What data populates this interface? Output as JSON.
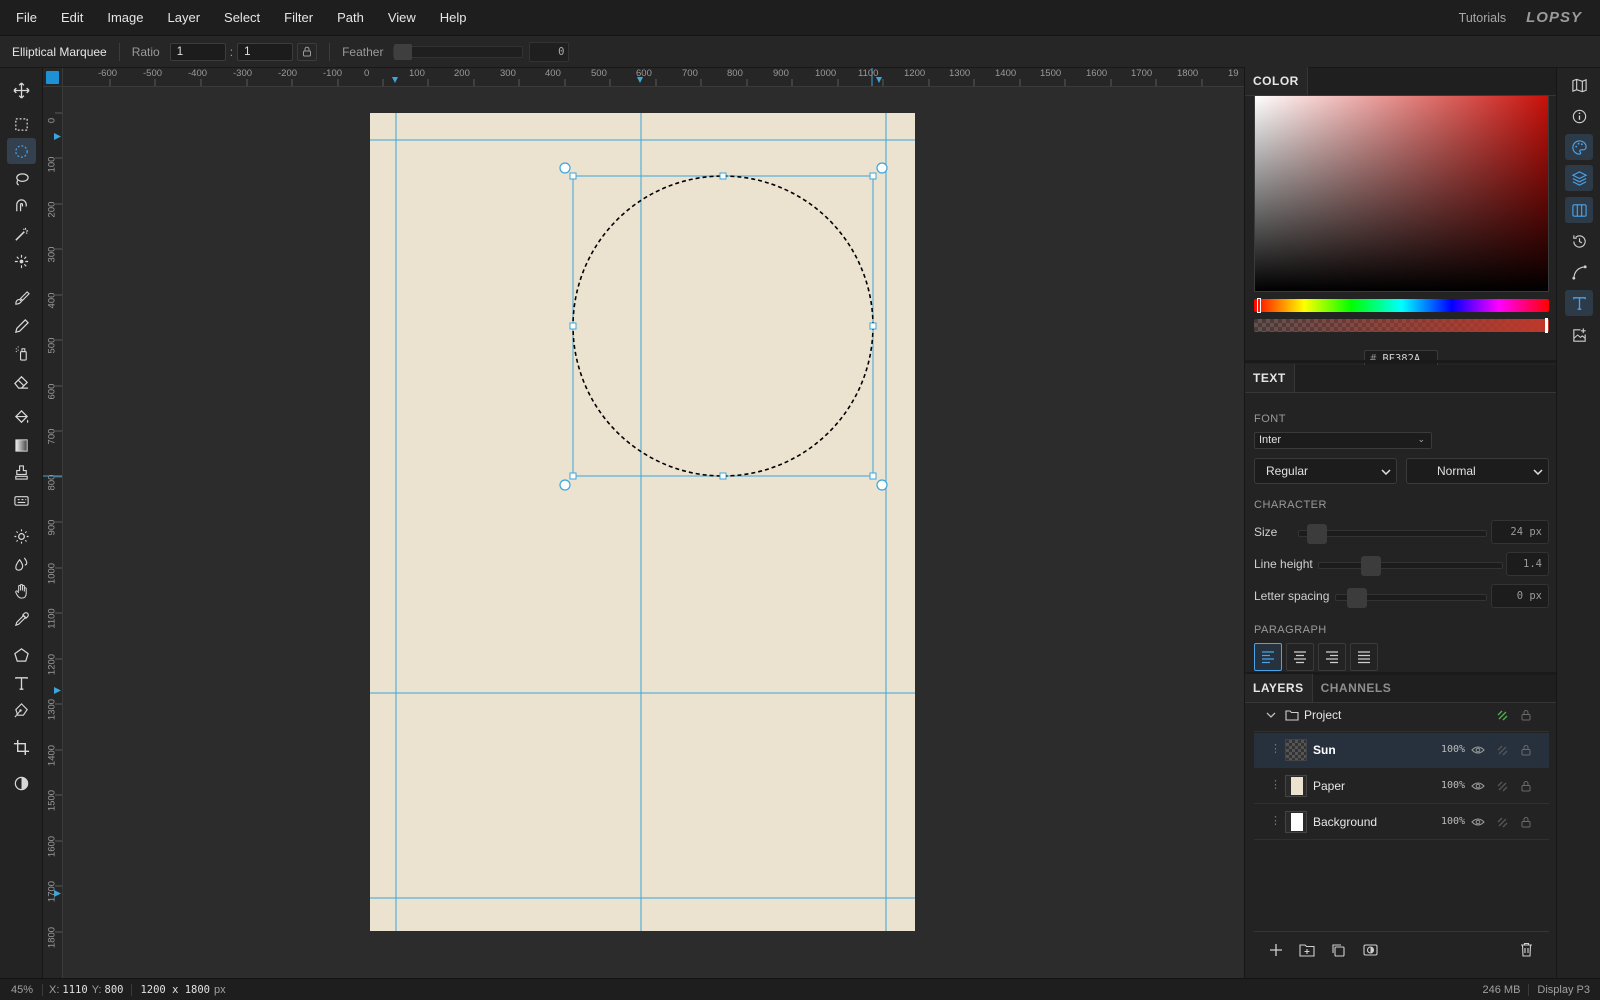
{
  "menu": {
    "items": [
      "File",
      "Edit",
      "Image",
      "Layer",
      "Select",
      "Filter",
      "Path",
      "View",
      "Help"
    ],
    "tutorials": "Tutorials",
    "logo": "LOPSY"
  },
  "options": {
    "tool_name": "Elliptical Marquee",
    "ratio_label": "Ratio",
    "ratio_w": "1",
    "ratio_sep": ":",
    "ratio_h": "1",
    "feather_label": "Feather",
    "feather_value": "0"
  },
  "tools": [
    {
      "name": "move-tool",
      "icon": "move-icon"
    },
    {
      "name": "rect-marquee-tool",
      "icon": "rect-marquee-icon"
    },
    {
      "name": "ellipse-marquee-tool",
      "icon": "ellipse-marquee-icon",
      "active": true
    },
    {
      "name": "lasso-tool",
      "icon": "lasso-icon"
    },
    {
      "name": "magnetic-lasso-tool",
      "icon": "magnetic-lasso-icon"
    },
    {
      "name": "magic-wand-tool",
      "icon": "magic-wand-icon"
    },
    {
      "name": "quick-select-tool",
      "icon": "quick-select-icon"
    },
    {
      "name": "brush-tool",
      "icon": "brush-icon"
    },
    {
      "name": "pencil-tool",
      "icon": "pencil-icon"
    },
    {
      "name": "spray-tool",
      "icon": "spray-icon"
    },
    {
      "name": "eraser-tool",
      "icon": "eraser-icon"
    },
    {
      "name": "bucket-tool",
      "icon": "paint-bucket-icon"
    },
    {
      "name": "gradient-tool",
      "icon": "gradient-icon"
    },
    {
      "name": "stamp-tool",
      "icon": "clone-stamp-icon"
    },
    {
      "name": "pattern-tool",
      "icon": "pattern-stamp-icon"
    },
    {
      "name": "dodge-tool",
      "icon": "dodge-icon"
    },
    {
      "name": "blur-tool",
      "icon": "blur-icon"
    },
    {
      "name": "hand-tool",
      "icon": "hand-icon"
    },
    {
      "name": "eyedropper-tool",
      "icon": "eyedropper-icon"
    },
    {
      "name": "shape-tool",
      "icon": "polygon-icon"
    },
    {
      "name": "text-tool",
      "icon": "text-icon"
    },
    {
      "name": "pen-tool",
      "icon": "pen-icon"
    },
    {
      "name": "crop-tool",
      "icon": "crop-icon"
    },
    {
      "name": "mask-mode-tool",
      "icon": "contrast-icon"
    }
  ],
  "rulers": {
    "top_ticks": [
      "-600",
      "-500",
      "-400",
      "-300",
      "-200",
      "-100",
      "0",
      "100",
      "200",
      "300",
      "400",
      "500",
      "600",
      "700",
      "800",
      "900",
      "1000",
      "1100",
      "1200",
      "1300",
      "1400",
      "1500",
      "1600",
      "1700",
      "1800",
      "19"
    ],
    "left_ticks": [
      "0",
      "100",
      "200",
      "300",
      "400",
      "500",
      "600",
      "700",
      "800",
      "900",
      "1000",
      "1100",
      "1200",
      "1300",
      "1400",
      "1500",
      "1600",
      "1700",
      "1800"
    ]
  },
  "canvas": {
    "document_color": "#EBE3D0",
    "guide_color": "#3AA6DD"
  },
  "color_panel": {
    "tab": "COLOR",
    "hex_prefix": "#",
    "hex": "BF382A",
    "hue_color": "#BF382A"
  },
  "text_panel": {
    "tab": "TEXT",
    "font_label": "FONT",
    "font_family": "Inter",
    "font_weight": "Regular",
    "font_style": "Normal",
    "character_label": "CHARACTER",
    "size_label": "Size",
    "size_value": "24 px",
    "line_height_label": "Line height",
    "line_height_value": "1.4",
    "letter_spacing_label": "Letter spacing",
    "letter_spacing_value": "0 px",
    "paragraph_label": "PARAGRAPH"
  },
  "layers_panel": {
    "tabs": [
      "LAYERS",
      "CHANNELS"
    ],
    "group_name": "Project",
    "layers": [
      {
        "name": "Sun",
        "opacity": "100%",
        "selected": true
      },
      {
        "name": "Paper",
        "opacity": "100%",
        "selected": false
      },
      {
        "name": "Background",
        "opacity": "100%",
        "selected": false
      }
    ]
  },
  "status": {
    "zoom": "45%",
    "x_label": "X:",
    "x_value": "1110",
    "y_label": "Y:",
    "y_value": "800",
    "doc_size": "1200 x 1800",
    "doc_unit": "px",
    "memory": "246 MB",
    "color_profile": "Display P3"
  }
}
